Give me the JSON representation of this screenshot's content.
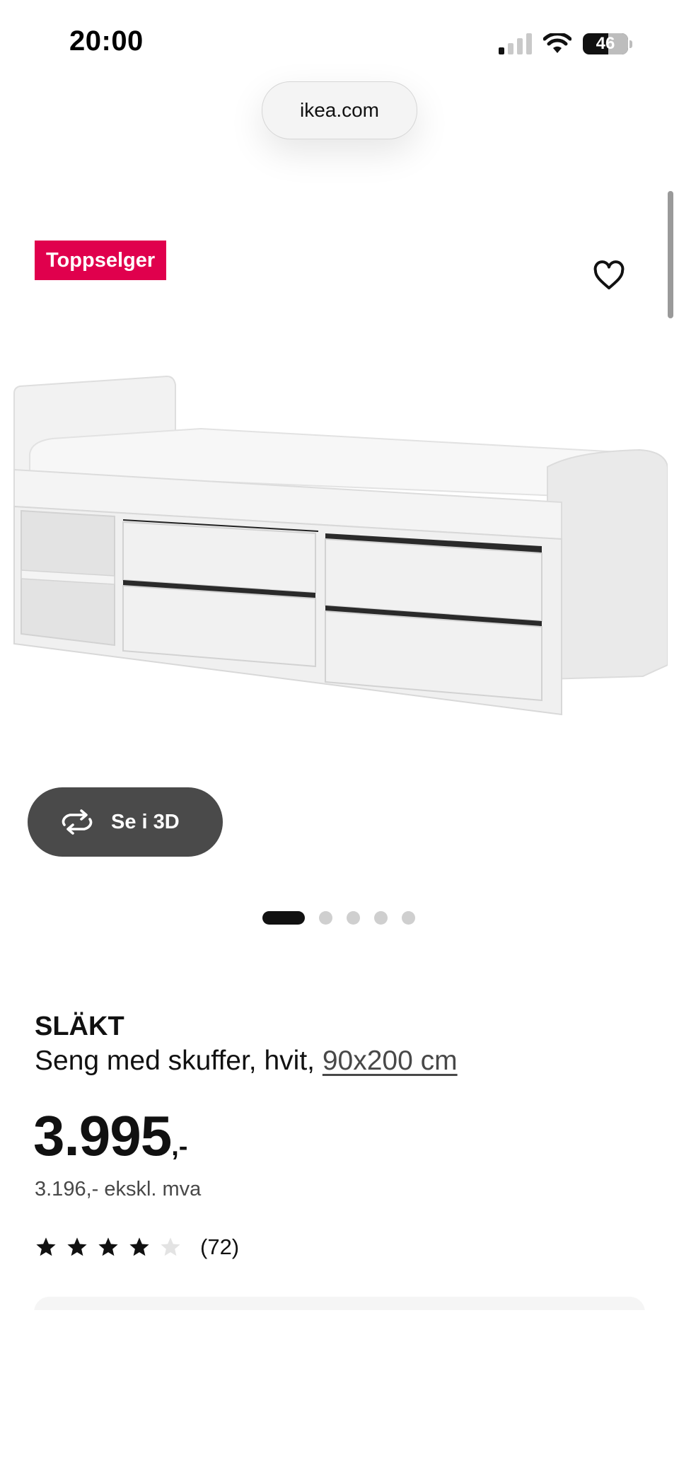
{
  "status_bar": {
    "time": "20:00",
    "battery": "46",
    "signal_bars_active": 1
  },
  "browser": {
    "url": "ikea.com"
  },
  "product": {
    "badge": "Toppselger",
    "view_3d_label": "Se i 3D",
    "gallery": {
      "total": 5,
      "active_index": 0
    },
    "brand": "SLÄKT",
    "description": "Seng med skuffer, hvit, ",
    "size": "90x200 cm",
    "price": "3.995",
    "price_suffix": ",-",
    "price_excl_vat": "3.196,- ekskl. mva",
    "rating": {
      "value": 4,
      "max": 5,
      "count": "(72)"
    }
  },
  "colors": {
    "badge": "#e0004d",
    "button_3d": "#4a4a4a",
    "text": "#111111",
    "muted": "#484848"
  },
  "icons": {
    "favorite": "heart-outline-icon",
    "view3d": "rotate-3d-icon",
    "star": "star-icon"
  }
}
